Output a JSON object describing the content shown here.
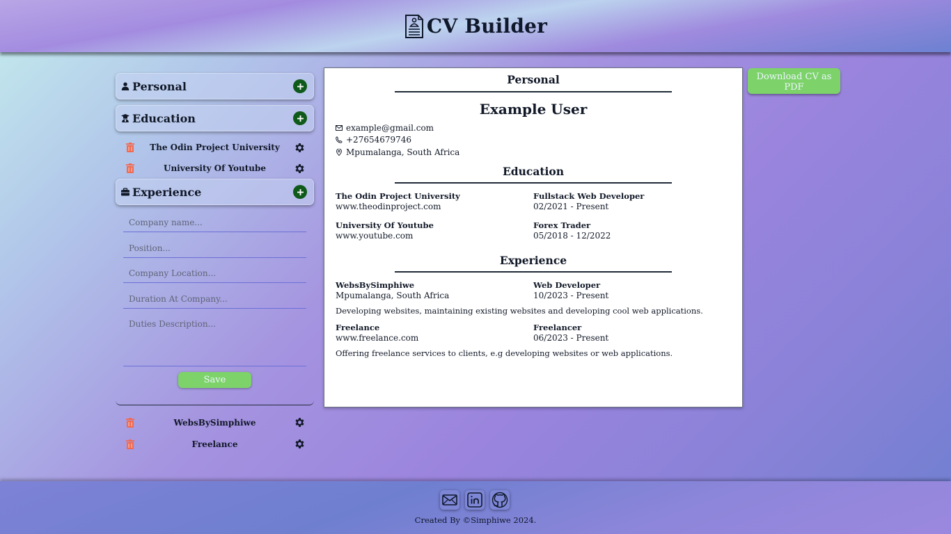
{
  "header": {
    "title": "CV Builder",
    "icon": "resume-icon"
  },
  "sidebar": {
    "personal": {
      "label": "Personal",
      "icon": "person-icon"
    },
    "education": {
      "label": "Education",
      "icon": "graduate-icon",
      "items": [
        {
          "name": "The Odin Project University"
        },
        {
          "name": "University Of Youtube"
        }
      ]
    },
    "experience": {
      "label": "Experience",
      "icon": "briefcase-icon",
      "form": {
        "company_placeholder": "Company name...",
        "position_placeholder": "Position...",
        "location_placeholder": "Company Location...",
        "duration_placeholder": "Duration At Company...",
        "duties_placeholder": "Duties Description...",
        "save_label": "Save"
      },
      "items": [
        {
          "name": "WebsBySimphiwe"
        },
        {
          "name": "Freelance"
        }
      ]
    }
  },
  "cv": {
    "personal_title": "Personal",
    "name": "Example User",
    "email": "example@gmail.com",
    "phone": "+27654679746",
    "location": "Mpumalanga, South Africa",
    "education_title": "Education",
    "education": [
      {
        "school": "The Odin Project University",
        "url": "www.theodinproject.com",
        "degree": "Fullstack Web Developer",
        "dates": "02/2021 - Present"
      },
      {
        "school": "University Of Youtube",
        "url": "www.youtube.com",
        "degree": "Forex Trader",
        "dates": "05/2018 - 12/2022"
      }
    ],
    "experience_title": "Experience",
    "experience": [
      {
        "company": "WebsBySimphiwe",
        "location": "Mpumalanga, South Africa",
        "position": "Web Developer",
        "dates": "10/2023 - Present",
        "description": "Developing websites, maintaining existing websites and developing cool web applications."
      },
      {
        "company": "Freelance",
        "location": "www.freelance.com",
        "position": "Freelancer",
        "dates": "06/2023 - Present",
        "description": "Offering freelance services to clients, e.g developing websites or web applications."
      }
    ]
  },
  "download": {
    "label": "Download CV as PDF"
  },
  "footer": {
    "credit": "Created By ©Simphiwe 2024."
  },
  "colors": {
    "accent_green": "#7dd36a",
    "plus_green": "#0f5a1a",
    "trash_red": "#f06a52"
  }
}
